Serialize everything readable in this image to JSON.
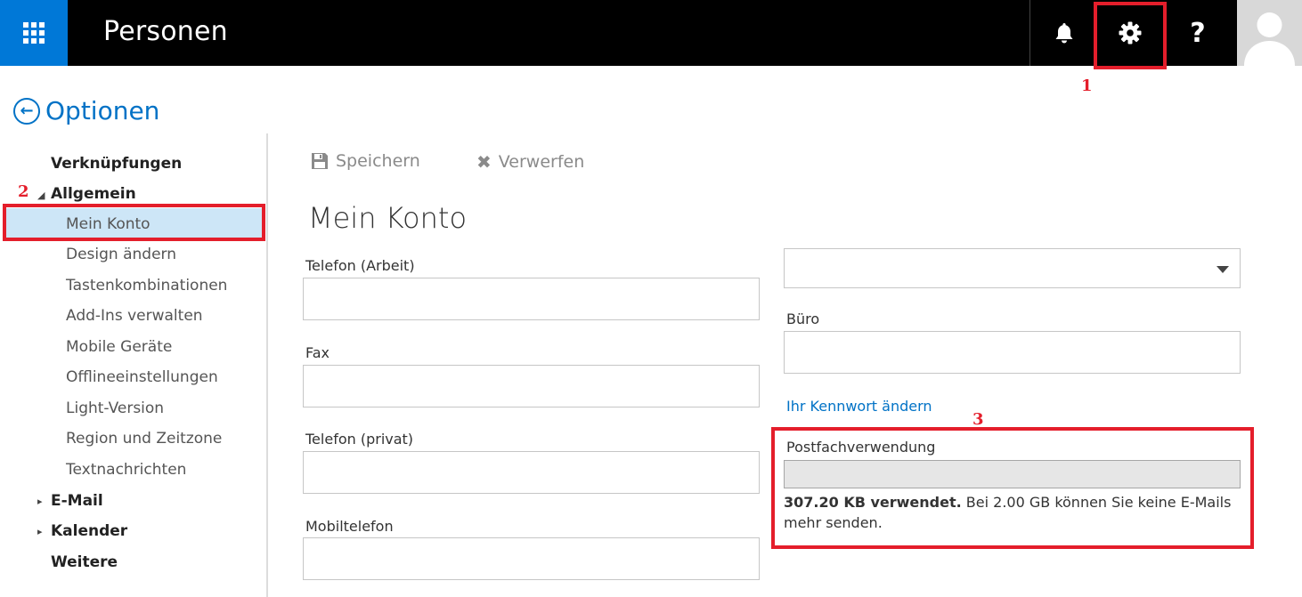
{
  "header": {
    "app_title": "Personen",
    "icons": [
      "waffle-icon",
      "bell-icon",
      "gear-icon",
      "help-icon",
      "avatar"
    ],
    "help_glyph": "?"
  },
  "options": {
    "title": "Optionen"
  },
  "sidebar": {
    "items": [
      {
        "label": "Verknüpfungen",
        "level": 0
      },
      {
        "label": "Allgemein",
        "level": 0,
        "expanded": true
      },
      {
        "label": "Mein Konto",
        "level": 1,
        "selected": true
      },
      {
        "label": "Design ändern",
        "level": 1
      },
      {
        "label": "Tastenkombinationen",
        "level": 1
      },
      {
        "label": "Add-Ins verwalten",
        "level": 1
      },
      {
        "label": "Mobile Geräte",
        "level": 1
      },
      {
        "label": "Offlineeinstellungen",
        "level": 1
      },
      {
        "label": "Light-Version",
        "level": 1
      },
      {
        "label": "Region und Zeitzone",
        "level": 1
      },
      {
        "label": "Textnachrichten",
        "level": 1
      },
      {
        "label": "E-Mail",
        "level": 0,
        "expanded": false
      },
      {
        "label": "Kalender",
        "level": 0,
        "expanded": false
      },
      {
        "label": "Weitere",
        "level": 0
      }
    ]
  },
  "toolbar": {
    "save_label": "Speichern",
    "discard_label": "Verwerfen"
  },
  "main": {
    "title": "Mein Konto",
    "fields_left": [
      {
        "label": "Telefon (Arbeit)",
        "value": ""
      },
      {
        "label": "Fax",
        "value": ""
      },
      {
        "label": "Telefon (privat)",
        "value": ""
      },
      {
        "label": "Mobiltelefon",
        "value": ""
      }
    ],
    "country_select": {
      "value": ""
    },
    "office": {
      "label": "Büro",
      "value": ""
    },
    "change_password_link": "Ihr Kennwort ändern",
    "mailbox_usage": {
      "label": "Postfachverwendung",
      "used_text": "307.20 KB verwendet.",
      "limit_text": " Bei 2.00 GB können Sie keine E-Mails mehr senden.",
      "fraction_used": 0.00015
    }
  },
  "annotations": {
    "one": "1",
    "two": "2",
    "three": "3"
  },
  "colors": {
    "accent": "#0072c6",
    "topbar": "#000000",
    "waffle": "#0078d7",
    "annotation": "#e41e2b",
    "selected": "#cde6f7"
  }
}
